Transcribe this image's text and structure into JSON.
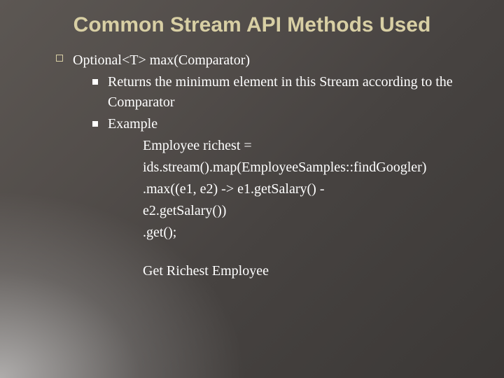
{
  "title": "Common Stream API Methods Used",
  "bullet1": "Optional<T> max(Comparator)",
  "sub1": "Returns the minimum element in this Stream according to the Comparator",
  "sub2": "Example",
  "code": {
    "l1": "Employee richest =",
    "l2": "ids.stream().map(EmployeeSamples::findGoogler)",
    "l3": ".max((e1, e2) -> e1.getSalary() -",
    "l4": "e2.getSalary())",
    "l5": ".get();",
    "l6": "Get Richest Employee"
  }
}
